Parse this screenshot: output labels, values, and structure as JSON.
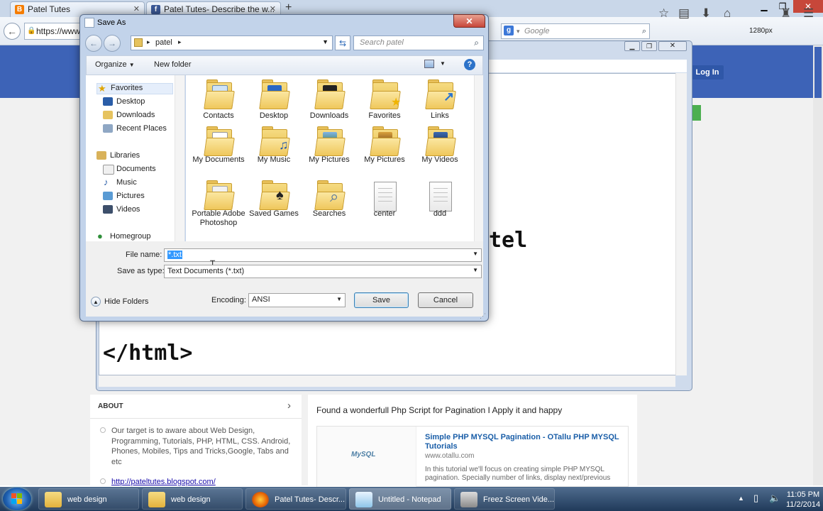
{
  "browser": {
    "tabs": [
      {
        "label": "Patel Tutes"
      },
      {
        "label": "Patel Tutes- Describe the w..."
      }
    ],
    "new_tab": "+",
    "url": "https://www",
    "search_placeholder": "Google",
    "resolution_label": "1280px",
    "window_controls": {
      "min": "▁",
      "max": "❐",
      "close": "✕"
    }
  },
  "blog": {
    "login_label": "Log In",
    "about": {
      "heading": "ABOUT",
      "text": "Our target is to aware about Web Design, Programming, Tutorials, PHP, HTML, CSS. Android, Phones, Mobiles, Tips and Tricks,Google, Tabs and etc",
      "link": "http://pateltutes.blogspot.com/"
    },
    "post": {
      "intro": "Found a wonderfull Php Script for Pagination I Apply it and happy",
      "card_title": "Simple PHP MYSQL Pagination - OTallu PHP MYSQL Tutorials",
      "card_site": "www.otallu.com",
      "card_desc": "In this tutorial we'll focus on creating simple PHP MYSQL pagination. Specially number of links, display next/previous",
      "card_logo": "MySQL"
    }
  },
  "notepad": {
    "code_line_1": "tel",
    "code_line_2": "</html>"
  },
  "dialog": {
    "title": "Save As",
    "breadcrumb": "patel",
    "search_placeholder": "Search patel",
    "organize_label": "Organize",
    "new_folder_label": "New folder",
    "nav": {
      "favorites": "Favorites",
      "favorites_items": [
        "Desktop",
        "Downloads",
        "Recent Places"
      ],
      "libraries": "Libraries",
      "libraries_items": [
        "Documents",
        "Music",
        "Pictures",
        "Videos"
      ],
      "homegroup": "Homegroup"
    },
    "files": [
      {
        "label": "Contacts"
      },
      {
        "label": "Desktop"
      },
      {
        "label": "Downloads"
      },
      {
        "label": "Favorites"
      },
      {
        "label": "Links"
      },
      {
        "label": "My Documents"
      },
      {
        "label": "My Music"
      },
      {
        "label": "My Pictures"
      },
      {
        "label": "My Pictures"
      },
      {
        "label": "My Videos"
      },
      {
        "label": "Portable Adobe Photoshop"
      },
      {
        "label": "Saved Games"
      },
      {
        "label": "Searches"
      },
      {
        "label": "center"
      },
      {
        "label": "ddd"
      }
    ],
    "file_name_label": "File name:",
    "file_name_value": "*.txt",
    "save_type_label": "Save as type:",
    "save_type_value": "Text Documents (*.txt)",
    "hide_folders_label": "Hide Folders",
    "encoding_label": "Encoding:",
    "encoding_value": "ANSI",
    "save_label": "Save",
    "cancel_label": "Cancel",
    "close_symbol": "✕"
  },
  "taskbar": {
    "buttons": [
      {
        "label": "web design"
      },
      {
        "label": "web design"
      },
      {
        "label": "Patel Tutes- Descr..."
      },
      {
        "label": "Untitled - Notepad"
      },
      {
        "label": "Freez Screen Vide..."
      }
    ],
    "time": "11:05 PM",
    "date": "11/2/2014"
  },
  "colors": {
    "blog_blue": "#3d63b7",
    "dialog_frame": "#c2d3ea",
    "selection": "#3399ff"
  }
}
